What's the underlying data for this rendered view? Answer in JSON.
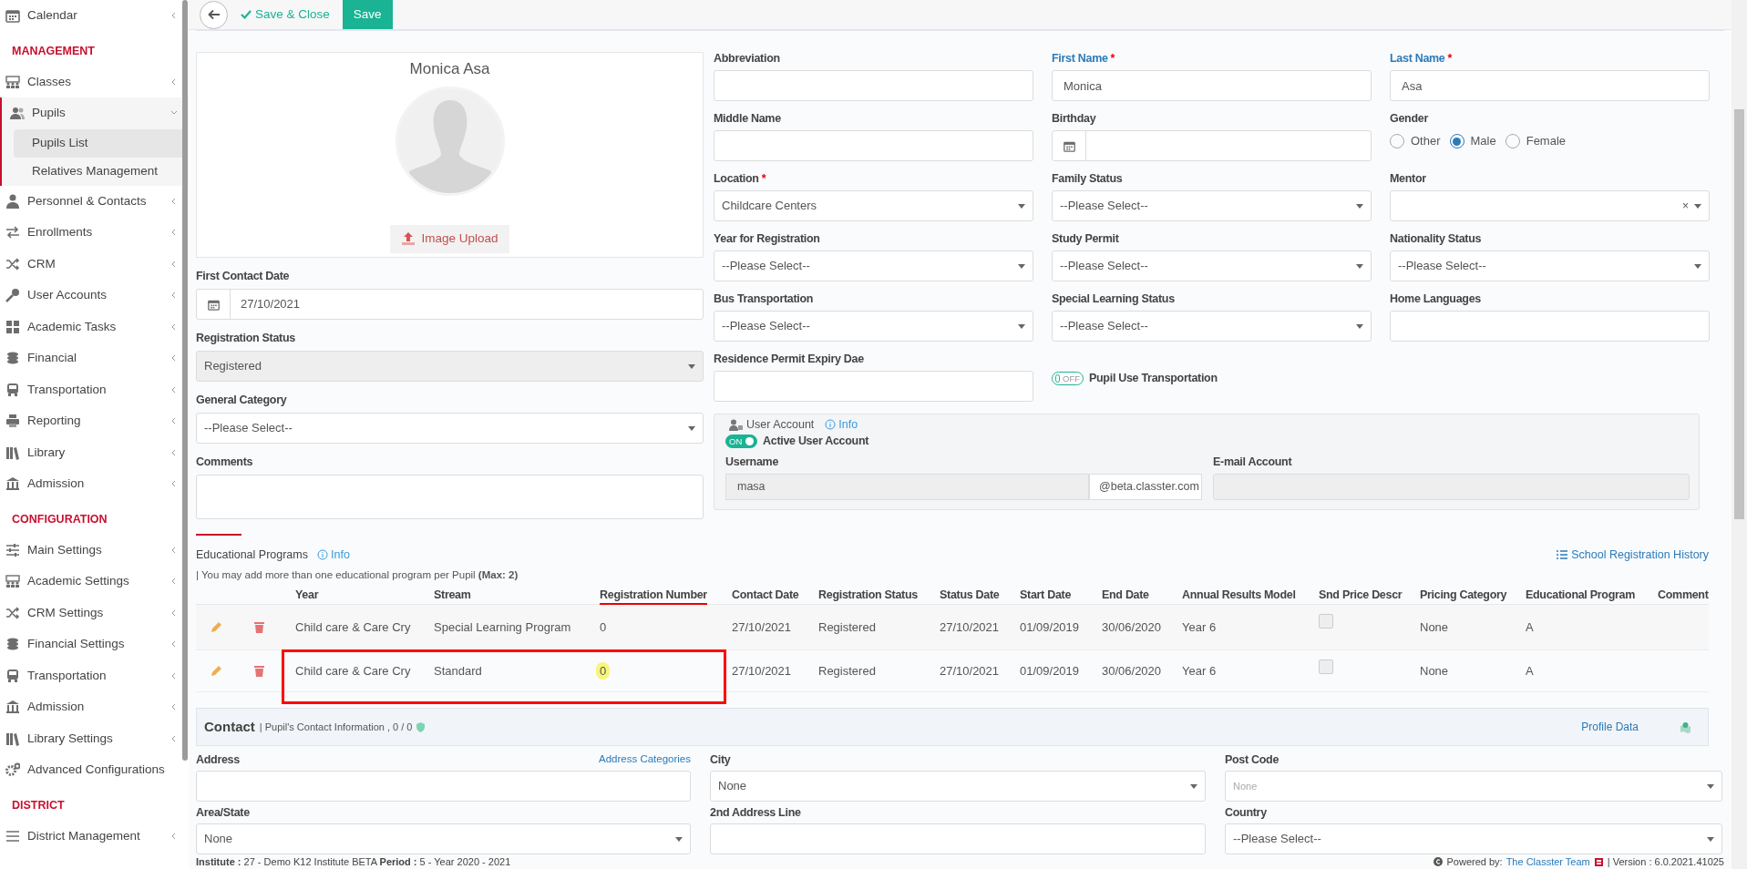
{
  "sidebar": {
    "items": [
      {
        "kind": "item",
        "label": "Calendar",
        "expandable": true,
        "expanded": false,
        "selected": false
      },
      {
        "kind": "header",
        "label": "MANAGEMENT"
      },
      {
        "kind": "item",
        "label": "Classes",
        "expandable": true,
        "expanded": false,
        "selected": false
      },
      {
        "kind": "item",
        "label": "Pupils",
        "expandable": true,
        "expanded": true,
        "selected": false,
        "children": [
          {
            "label": "Pupils List",
            "selected": true
          },
          {
            "label": "Relatives Management",
            "selected": false
          }
        ]
      },
      {
        "kind": "item",
        "label": "Personnel & Contacts",
        "expandable": true,
        "expanded": false,
        "selected": false
      },
      {
        "kind": "item",
        "label": "Enrollments",
        "expandable": true,
        "expanded": false,
        "selected": false
      },
      {
        "kind": "item",
        "label": "CRM",
        "expandable": true,
        "expanded": false,
        "selected": false
      },
      {
        "kind": "item",
        "label": "User Accounts",
        "expandable": true,
        "expanded": false,
        "selected": false
      },
      {
        "kind": "item",
        "label": "Academic Tasks",
        "expandable": true,
        "expanded": false,
        "selected": false
      },
      {
        "kind": "item",
        "label": "Financial",
        "expandable": true,
        "expanded": false,
        "selected": false
      },
      {
        "kind": "item",
        "label": "Transportation",
        "expandable": true,
        "expanded": false,
        "selected": false
      },
      {
        "kind": "item",
        "label": "Reporting",
        "expandable": true,
        "expanded": false,
        "selected": false
      },
      {
        "kind": "item",
        "label": "Library",
        "expandable": true,
        "expanded": false,
        "selected": false
      },
      {
        "kind": "item",
        "label": "Admission",
        "expandable": true,
        "expanded": false,
        "selected": false
      },
      {
        "kind": "header",
        "label": "CONFIGURATION"
      },
      {
        "kind": "item",
        "label": "Main Settings",
        "expandable": true,
        "expanded": false,
        "selected": false
      },
      {
        "kind": "item",
        "label": "Academic Settings",
        "expandable": true,
        "expanded": false,
        "selected": false
      },
      {
        "kind": "item",
        "label": "CRM Settings",
        "expandable": true,
        "expanded": false,
        "selected": false
      },
      {
        "kind": "item",
        "label": "Financial Settings",
        "expandable": true,
        "expanded": false,
        "selected": false
      },
      {
        "kind": "item",
        "label": "Transportation",
        "expandable": true,
        "expanded": false,
        "selected": false
      },
      {
        "kind": "item",
        "label": "Admission",
        "expandable": true,
        "expanded": false,
        "selected": false
      },
      {
        "kind": "item",
        "label": "Library Settings",
        "expandable": true,
        "expanded": false,
        "selected": false
      },
      {
        "kind": "item",
        "label": "Advanced Configurations",
        "expandable": false,
        "expanded": false,
        "selected": false
      },
      {
        "kind": "header",
        "label": "DISTRICT"
      },
      {
        "kind": "item",
        "label": "District Management",
        "expandable": true,
        "expanded": false,
        "selected": false
      }
    ]
  },
  "toolbar": {
    "save_close": "Save & Close",
    "save": "Save"
  },
  "profile": {
    "name": "Monica Asa",
    "upload": "Image Upload"
  },
  "left_fields": [
    {
      "kind": "date",
      "label": "First Contact Date",
      "value": "27/10/2021"
    },
    {
      "kind": "select",
      "label": "Registration Status",
      "value": "Registered",
      "disabled": true
    },
    {
      "kind": "select",
      "label": "General Category",
      "value": "--Please Select--",
      "disabled": false
    },
    {
      "kind": "textarea",
      "label": "Comments"
    }
  ],
  "fields": [
    {
      "kind": "text",
      "label": "Abbreviation",
      "emphasized": false
    },
    {
      "kind": "text",
      "label": "First Name",
      "required_mark": "*",
      "emphasized": true,
      "value": "Monica"
    },
    {
      "kind": "text",
      "label": "Last Name",
      "required_mark": "*",
      "emphasized": true,
      "value": "Asa"
    },
    {
      "kind": "text",
      "label": "Middle Name",
      "emphasized": false
    },
    {
      "kind": "date",
      "label": "Birthday",
      "emphasized": false
    },
    {
      "kind": "radio",
      "label": "Gender",
      "emphasized": false,
      "options": [
        {
          "label": "Other",
          "selected": false
        },
        {
          "label": "Male",
          "selected": true
        },
        {
          "label": "Female",
          "selected": false
        }
      ]
    },
    {
      "kind": "select",
      "label": "Location",
      "required_mark": "*",
      "emphasized": false,
      "value": "Childcare Centers"
    },
    {
      "kind": "select",
      "label": "Family Status",
      "emphasized": false,
      "value": "--Please Select--"
    },
    {
      "kind": "clearable",
      "label": "Mentor",
      "emphasized": false,
      "clear": "×"
    },
    {
      "kind": "select",
      "label": "Year for Registration",
      "emphasized": false,
      "value": "--Please Select--"
    },
    {
      "kind": "select",
      "label": "Study Permit",
      "emphasized": false,
      "value": "--Please Select--"
    },
    {
      "kind": "select",
      "label": "Nationality Status",
      "emphasized": false,
      "value": "--Please Select--"
    },
    {
      "kind": "select",
      "label": "Bus Transportation",
      "emphasized": false,
      "value": "--Please Select--"
    },
    {
      "kind": "select",
      "label": "Special Learning Status",
      "emphasized": false,
      "value": "--Please Select--"
    },
    {
      "kind": "text",
      "label": "Home Languages",
      "emphasized": false
    },
    {
      "kind": "text",
      "label": "Residence Permit Expiry Dae",
      "emphasized": false
    },
    {
      "kind": "toggle",
      "label": "Pupil Use Transportation",
      "on": false,
      "toggle_text": "OFF"
    }
  ],
  "user_account": {
    "title": "User Account",
    "info": "Info",
    "toggle_on": true,
    "toggle_text": "ON",
    "toggle_label": "Active User Account",
    "username_label": "Username",
    "username": "masa",
    "domain": "@beta.classter.com",
    "email_label": "E-mail Account"
  },
  "programs": {
    "title": "Educational Programs",
    "info": "Info",
    "history": "School Registration History",
    "note": "| You may add more than one educational program per Pupil **(Max: 2)**",
    "columns": [
      {
        "kind": "text",
        "label": "Year",
        "underlined": false
      },
      {
        "kind": "text",
        "label": "Stream",
        "underlined": false
      },
      {
        "kind": "text",
        "label": "Registration Number",
        "underlined": true
      },
      {
        "kind": "text",
        "label": "Contact Date",
        "underlined": false
      },
      {
        "kind": "text",
        "label": "Registration Status",
        "underlined": false
      },
      {
        "kind": "text",
        "label": "Status Date",
        "underlined": false
      },
      {
        "kind": "text",
        "label": "Start Date",
        "underlined": false
      },
      {
        "kind": "text",
        "label": "End Date",
        "underlined": false
      },
      {
        "kind": "text",
        "label": "Annual Results Model",
        "underlined": false
      },
      {
        "kind": "checkbox",
        "label": "Snd Price Descr",
        "underlined": false
      },
      {
        "kind": "text",
        "label": "Pricing Category",
        "underlined": false
      },
      {
        "kind": "text",
        "label": "Educational Program",
        "underlined": false
      },
      {
        "kind": "blank",
        "label": "Comment",
        "underlined": false
      }
    ],
    "rows": [
      {
        "cells": [
          "Child care & Care Cry",
          "Special Learning Program",
          "0",
          "27/10/2021",
          "Registered",
          "27/10/2021",
          "01/09/2019",
          "30/06/2020",
          "Year 6",
          "",
          "None",
          "A",
          ""
        ],
        "checked": false,
        "boxed": false,
        "marked": false
      },
      {
        "cells": [
          "Child care & Care Cry",
          "Standard",
          "0",
          "27/10/2021",
          "Registered",
          "27/10/2021",
          "01/09/2019",
          "30/06/2020",
          "Year 6",
          "",
          "None",
          "A",
          ""
        ],
        "checked": false,
        "boxed": true,
        "marked": true
      }
    ]
  },
  "contact": {
    "title": "Contact",
    "subtitle": "| Pupil's Contact Information , 0 / 0",
    "profile_link": "Profile Data",
    "fields": [
      {
        "kind": "text",
        "label": "Address",
        "link": "Address Categories"
      },
      {
        "kind": "select",
        "label": "City",
        "value": "None"
      },
      {
        "kind": "select",
        "label": "Post Code",
        "placeholder": "None"
      },
      {
        "kind": "select",
        "label": "Area/State",
        "value": "None"
      },
      {
        "kind": "text",
        "label": "2nd Address Line"
      },
      {
        "kind": "select",
        "label": "Country",
        "value": "--Please Select--"
      }
    ]
  },
  "footer": {
    "info": "**Institute :** 27 - Demo K12 Institute BETA **Period :** 5 - Year 2020 - 2021",
    "powered": "Powered by:",
    "team": "The Classter Team",
    "version": "| Version : 6.0.2021.41025"
  }
}
